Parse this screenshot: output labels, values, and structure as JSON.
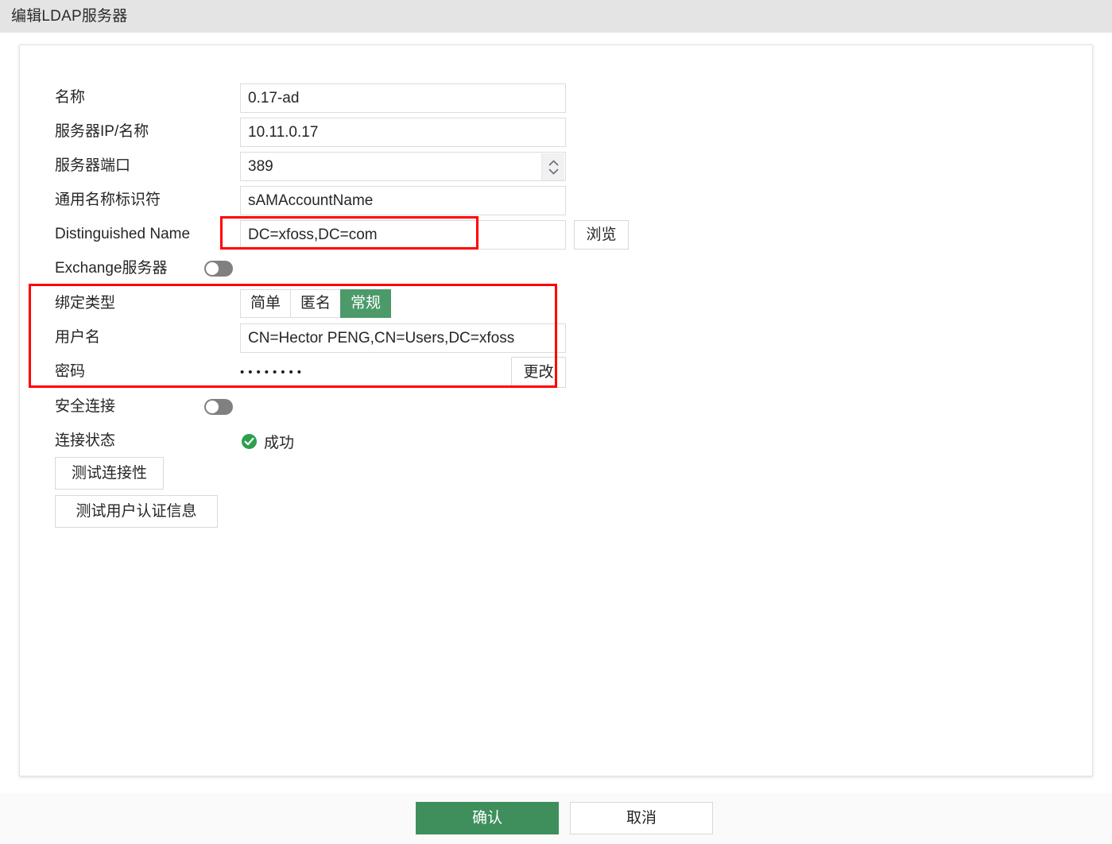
{
  "window": {
    "title": "编辑LDAP服务器"
  },
  "form": {
    "name": {
      "label": "名称",
      "value": "0.17-ad"
    },
    "server_ip": {
      "label": "服务器IP/名称",
      "value": "10.11.0.17"
    },
    "server_port": {
      "label": "服务器端口",
      "value": "389"
    },
    "common_name_identifier": {
      "label": "通用名称标识符",
      "value": "sAMAccountName"
    },
    "distinguished_name": {
      "label": "Distinguished Name",
      "value": "DC=xfoss,DC=com",
      "browse_label": "浏览"
    },
    "exchange_server": {
      "label": "Exchange服务器",
      "state": "off"
    },
    "bind_type": {
      "label": "绑定类型",
      "options": [
        "简单",
        "匿名",
        "常规"
      ],
      "selected": "常规"
    },
    "username": {
      "label": "用户名",
      "value": "CN=Hector PENG,CN=Users,DC=xfoss"
    },
    "password": {
      "label": "密码",
      "value": "••••••••",
      "change_label": "更改"
    },
    "secure_connection": {
      "label": "安全连接",
      "state": "off"
    },
    "connection_status": {
      "label": "连接状态",
      "value": "成功",
      "icon": "success-check-icon"
    },
    "test_connectivity_label": "测试连接性",
    "test_user_auth_label": "测试用户认证信息"
  },
  "footer": {
    "confirm_label": "确认",
    "cancel_label": "取消"
  },
  "colors": {
    "primary_green": "#3f8f5d",
    "segment_green": "#4c9a6a",
    "status_green": "#2e9e4f",
    "annotation_red": "#ff0000",
    "titlebar_bg": "#e4e4e4"
  }
}
